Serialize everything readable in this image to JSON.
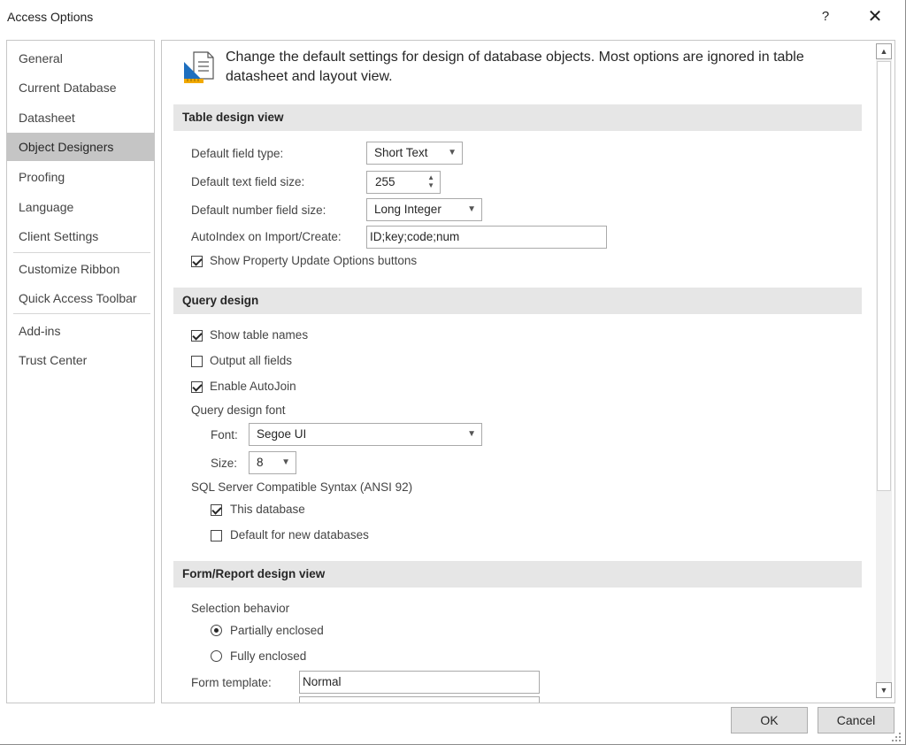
{
  "window": {
    "title": "Access Options",
    "help_label": "?",
    "close_label": "✕"
  },
  "nav": {
    "items": [
      {
        "label": "General"
      },
      {
        "label": "Current Database"
      },
      {
        "label": "Datasheet"
      },
      {
        "label": "Object Designers",
        "selected": true
      },
      {
        "label": "Proofing"
      },
      {
        "label": "Language"
      },
      {
        "label": "Client Settings"
      },
      {
        "label": "Customize Ribbon"
      },
      {
        "label": "Quick Access Toolbar"
      },
      {
        "label": "Add-ins"
      },
      {
        "label": "Trust Center"
      }
    ]
  },
  "intro": {
    "text": "Change the default settings for design of database objects. Most options are ignored in table datasheet and layout view.",
    "icon": "design-settings-icon"
  },
  "table_design": {
    "heading": "Table design view",
    "field_type_label": "Default field type:",
    "field_type_value": "Short Text",
    "text_size_label": "Default text field size:",
    "text_size_value": "255",
    "number_size_label": "Default number field size:",
    "number_size_value": "Long Integer",
    "autoindex_label": "AutoIndex on Import/Create:",
    "autoindex_value": "ID;key;code;num",
    "property_update_label": "Show Property Update Options buttons",
    "property_update_checked": true
  },
  "query_design": {
    "heading": "Query design",
    "show_table_names_label": "Show table names",
    "show_table_names_checked": true,
    "output_all_fields_label": "Output all fields",
    "output_all_fields_checked": false,
    "enable_autojoin_label": "Enable AutoJoin",
    "enable_autojoin_checked": true,
    "font_group_label": "Query design font",
    "font_label": "Font:",
    "font_value": "Segoe UI",
    "size_label": "Size:",
    "size_value": "8",
    "sql_label": "SQL Server Compatible Syntax (ANSI 92)",
    "this_db_label": "This database",
    "this_db_checked": true,
    "default_new_label": "Default for new databases",
    "default_new_checked": false
  },
  "form_report": {
    "heading": "Form/Report design view",
    "selection_label": "Selection behavior",
    "partially_label": "Partially enclosed",
    "fully_label": "Fully enclosed",
    "selected_behavior": "Partially enclosed",
    "form_template_label": "Form template:",
    "form_template_value": "Normal"
  },
  "footer": {
    "ok_label": "OK",
    "cancel_label": "Cancel"
  }
}
